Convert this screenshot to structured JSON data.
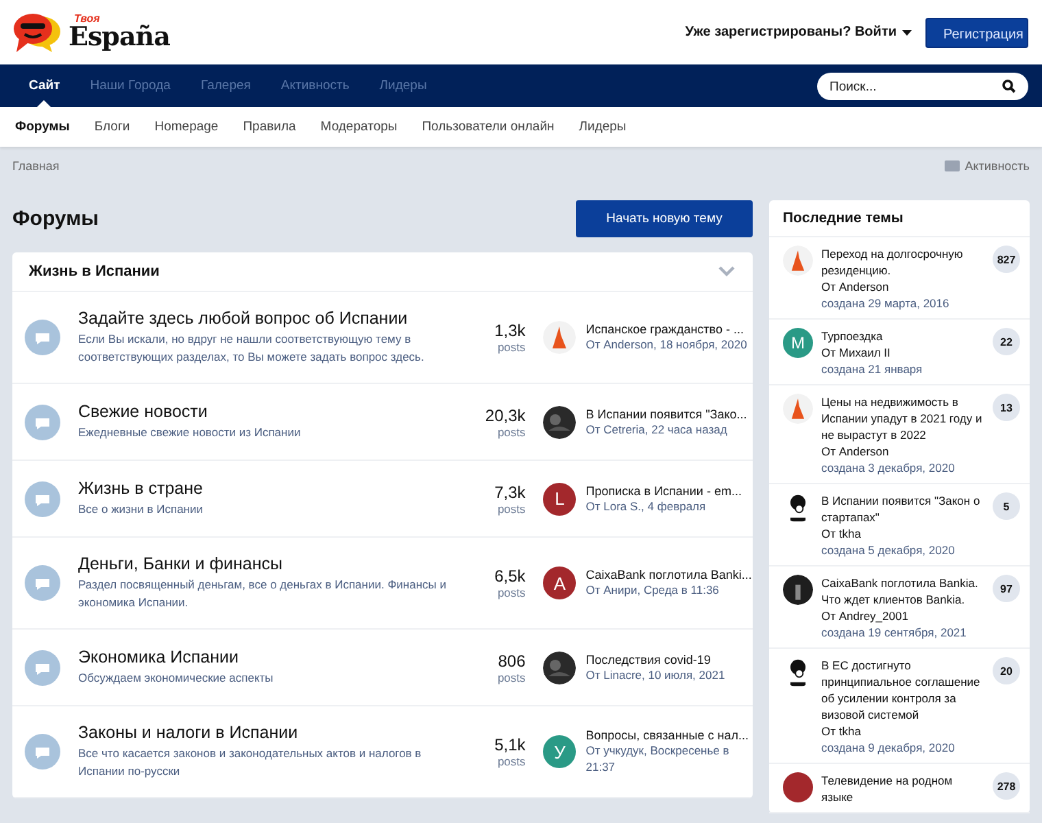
{
  "header": {
    "logo_small": "Твоя",
    "logo_main": "España",
    "login": "Уже зарегистрированы? Войти",
    "register": "Регистрация"
  },
  "nav": [
    {
      "label": "Сайт",
      "selected": true
    },
    {
      "label": "Наши Города",
      "selected": false
    },
    {
      "label": "Галерея",
      "selected": false
    },
    {
      "label": "Активность",
      "selected": false
    },
    {
      "label": "Лидеры",
      "selected": false
    }
  ],
  "search": {
    "placeholder": "Поиск..."
  },
  "subnav": [
    {
      "label": "Форумы",
      "selected": true
    },
    {
      "label": "Блоги",
      "selected": false
    },
    {
      "label": "Homepage",
      "selected": false
    },
    {
      "label": "Правила",
      "selected": false
    },
    {
      "label": "Модераторы",
      "selected": false
    },
    {
      "label": "Пользователи онлайн",
      "selected": false
    },
    {
      "label": "Лидеры",
      "selected": false
    }
  ],
  "breadcrumb": "Главная",
  "activity_link": "Активность",
  "page_title": "Форумы",
  "new_topic_button": "Начать новую тему",
  "category": {
    "title": "Жизнь в Испании",
    "expanded": true,
    "forums": [
      {
        "title": "Задайте здесь любой вопрос об Испании",
        "description": "Если Вы искали, но вдруг не нашли соответствующую тему в соответствующих разделах, то Вы можете задать вопрос здесь.",
        "count": "1,3k",
        "count_label": "posts",
        "avatar": {
          "kind": "image"
        },
        "last_title": "Испанское гражданство - ...",
        "last_meta": "От Anderson, 18 ноября, 2020"
      },
      {
        "title": "Свежие новости",
        "description": "Ежедневные свежие новости из Испании",
        "count": "20,3k",
        "count_label": "posts",
        "avatar": {
          "kind": "photo"
        },
        "last_title": "В Испании появится \"Зако...",
        "last_meta": "От Cetreria, 22 часа назад"
      },
      {
        "title": "Жизнь в стране",
        "description": "Все о жизни в Испании",
        "count": "7,3k",
        "count_label": "posts",
        "avatar": {
          "kind": "letter",
          "letter": "L",
          "color": "#a3282c"
        },
        "last_title": "Прописка в Испании - em...",
        "last_meta": "От Lora S., 4 февраля"
      },
      {
        "title": "Деньги, Банки и финансы",
        "description": "Раздел посвященный деньгам, все о деньгах в Испании. Финансы и экономика Испании.",
        "count": "6,5k",
        "count_label": "posts",
        "avatar": {
          "kind": "letter",
          "letter": "A",
          "color": "#a3282c"
        },
        "last_title": "CaixaBank поглотила Banki...",
        "last_meta": "От Анири, Среда в 11:36"
      },
      {
        "title": "Экономика Испании",
        "description": "Обсуждаем экономические аспекты",
        "count": "806",
        "count_label": "posts",
        "avatar": {
          "kind": "photo"
        },
        "last_title": "Последствия covid-19",
        "last_meta": "От Linacre, 10 июля, 2021"
      },
      {
        "title": "Законы и налоги в Испании",
        "description": "Все что касается законов и законодательных актов и налогов в Испании по-русски",
        "count": "5,1k",
        "count_label": "posts",
        "avatar": {
          "kind": "letter",
          "letter": "У",
          "color": "#2a9a86"
        },
        "last_title": "Вопросы, связанные с нал...",
        "last_meta": "От учкудук, Воскресенье в 21:37"
      }
    ]
  },
  "recent": {
    "title": "Последние темы",
    "topics": [
      {
        "title": "Переход на долгосрочную резиденцию.",
        "author": "От Anderson",
        "date": "создана 29 марта, 2016",
        "count": "827",
        "avatar": {
          "kind": "image"
        }
      },
      {
        "title": "Турпоездка",
        "author": "От Михаил II",
        "date": "создана 21 января",
        "count": "22",
        "avatar": {
          "kind": "letter",
          "letter": "M",
          "color": "#2a9a86"
        }
      },
      {
        "title": "Цены на недвижимость в Испании упадут в 2021 году и не вырастут в 2022",
        "author": "От Anderson",
        "date": "создана 3 декабря, 2020",
        "count": "13",
        "avatar": {
          "kind": "image"
        }
      },
      {
        "title": "В Испании появится \"Закон о стартапах\"",
        "author": "От tkha",
        "date": "создана 5 декабря, 2020",
        "count": "5",
        "avatar": {
          "kind": "drawing"
        }
      },
      {
        "title": "CaixaBank поглотила Bankia. Что ждет клиентов Bankia.",
        "author": "От Andrey_2001",
        "date": "создана 19 сентября, 2021",
        "count": "97",
        "avatar": {
          "kind": "photo"
        }
      },
      {
        "title": "В ЕС достигнуто принципиальное соглашение об усилении контроля за визовой системой",
        "author": "От tkha",
        "date": "создана 9 декабря, 2020",
        "count": "20",
        "avatar": {
          "kind": "drawing"
        }
      },
      {
        "title": "Телевидение на родном языке",
        "count": "278",
        "avatar": {
          "kind": "letter",
          "color": "#a3282c"
        }
      }
    ]
  }
}
